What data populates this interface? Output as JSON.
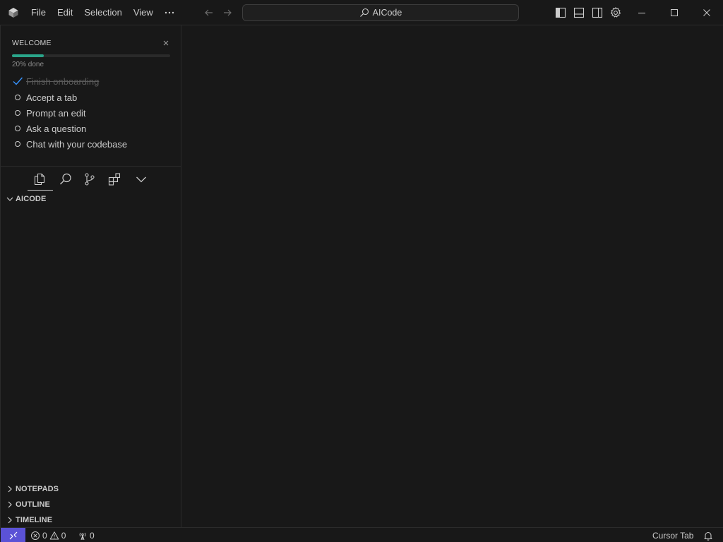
{
  "titlebar": {
    "menu": [
      "File",
      "Edit",
      "Selection",
      "View"
    ],
    "more_label": "···",
    "search_text": "AICode"
  },
  "welcome": {
    "title": "WELCOME",
    "progress_percent": 20,
    "progress_text": "20% done",
    "tasks": [
      {
        "label": "Finish onboarding",
        "done": true
      },
      {
        "label": "Accept a tab",
        "done": false
      },
      {
        "label": "Prompt an edit",
        "done": false
      },
      {
        "label": "Ask a question",
        "done": false
      },
      {
        "label": "Chat with your codebase",
        "done": false
      }
    ]
  },
  "explorer": {
    "folder": "AICODE"
  },
  "panels": {
    "notepads": "NOTEPADS",
    "outline": "OUTLINE",
    "timeline": "TIMELINE"
  },
  "statusbar": {
    "errors": "0",
    "warnings": "0",
    "ports": "0",
    "cursor_tab": "Cursor Tab"
  },
  "colors": {
    "accent": "#5b52d6",
    "progress": "#2aa58a",
    "check": "#3794ff",
    "background": "#181818"
  }
}
